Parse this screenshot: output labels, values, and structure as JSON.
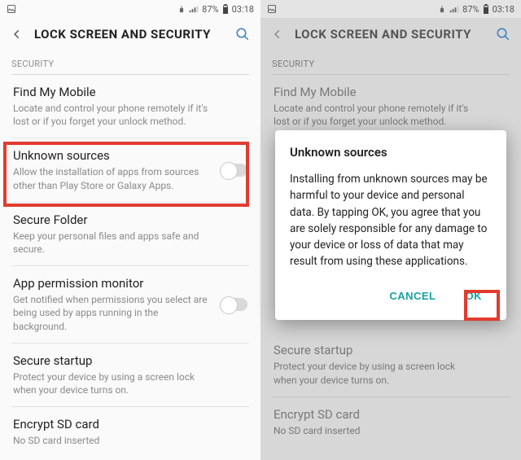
{
  "statusbar": {
    "battery_pct": "87%",
    "time": "03:18"
  },
  "header": {
    "title": "LOCK SCREEN AND SECURITY"
  },
  "section_label": "SECURITY",
  "items": {
    "find_my_mobile": {
      "title": "Find My Mobile",
      "sub": "Locate and control your phone remotely if it's lost or if you forget your unlock method."
    },
    "unknown_sources": {
      "title": "Unknown sources",
      "sub": "Allow the installation of apps from sources other than Play Store or Galaxy Apps."
    },
    "secure_folder": {
      "title": "Secure Folder",
      "sub": "Keep your personal files and apps safe and secure."
    },
    "app_permission": {
      "title": "App permission monitor",
      "sub": "Get notified when permissions you select are being used by apps running in the background."
    },
    "secure_startup": {
      "title": "Secure startup",
      "sub": "Protect your device by using a screen lock when your device turns on."
    },
    "encrypt_sd": {
      "title": "Encrypt SD card",
      "sub": "No SD card inserted"
    }
  },
  "dialog": {
    "title": "Unknown sources",
    "body": "Installing from unknown sources may be harmful to your device and personal data. By tapping OK, you agree that you are solely responsible for any damage to your device or loss of data that may result from using these applications.",
    "cancel": "CANCEL",
    "ok": "OK"
  }
}
